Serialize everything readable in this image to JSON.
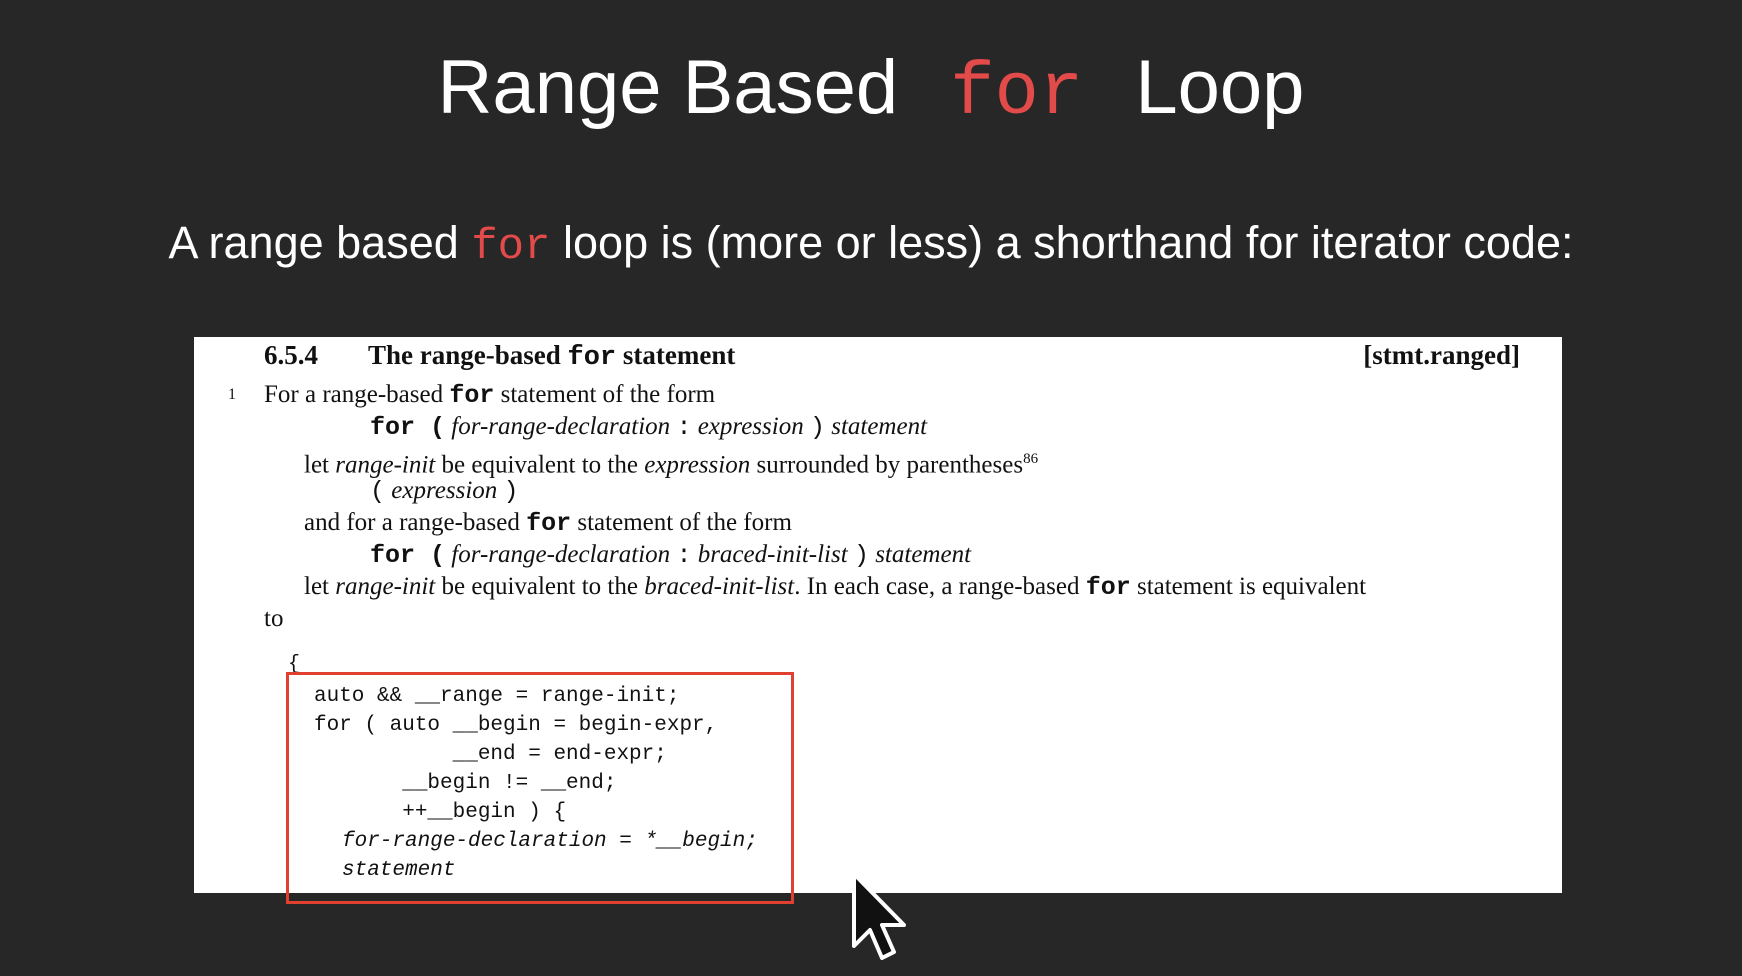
{
  "slide": {
    "title_pre": "Range Based",
    "title_kw": "for",
    "title_post": "Loop",
    "subtitle_pre": "A range based",
    "subtitle_kw": "for",
    "subtitle_post": "loop is (more or less) a shorthand for iterator code:"
  },
  "doc": {
    "section_number": "6.5.4",
    "section_title_pre": "The range-based",
    "section_title_kw": "for",
    "section_title_post": "statement",
    "section_tag": "[stmt.ranged]",
    "para_number": "1",
    "l1_pre": "For a range-based",
    "l1_kw": "for",
    "l1_post": "statement of the form",
    "l2_kw": "for (",
    "l2_decl": "for-range-declaration",
    "l2_colon": ":",
    "l2_expr": "expression",
    "l2_close": ")",
    "l2_stmt": "statement",
    "l3_let": "let",
    "l3_ri": "range-init",
    "l3_mid": "be equivalent to the",
    "l3_expr": "expression",
    "l3_post": "surrounded by parentheses",
    "l3_sup": "86",
    "l4_open": "(",
    "l4_expr": "expression",
    "l4_close": ")",
    "l5_pre": "and for a range-based",
    "l5_kw": "for",
    "l5_post": "statement of the form",
    "l6_kw": "for (",
    "l6_decl": "for-range-declaration",
    "l6_colon": ":",
    "l6_bil": "braced-init-list",
    "l6_close": ")",
    "l6_stmt": "statement",
    "l7_let": "let",
    "l7_ri": "range-init",
    "l7_mid": "be equivalent to the",
    "l7_bil": "braced-init-list",
    "l7_post1": ". In each case, a range-based",
    "l7_kw": "for",
    "l7_post2": "statement is equivalent",
    "l8": "to",
    "brace": "{",
    "code": [
      "auto && __range = range-init;",
      "for ( auto __begin = begin-expr,",
      "           __end = end-expr;",
      "       __begin != __end;",
      "       ++__begin ) {",
      "for-range-declaration = *__begin;",
      "statement"
    ]
  }
}
